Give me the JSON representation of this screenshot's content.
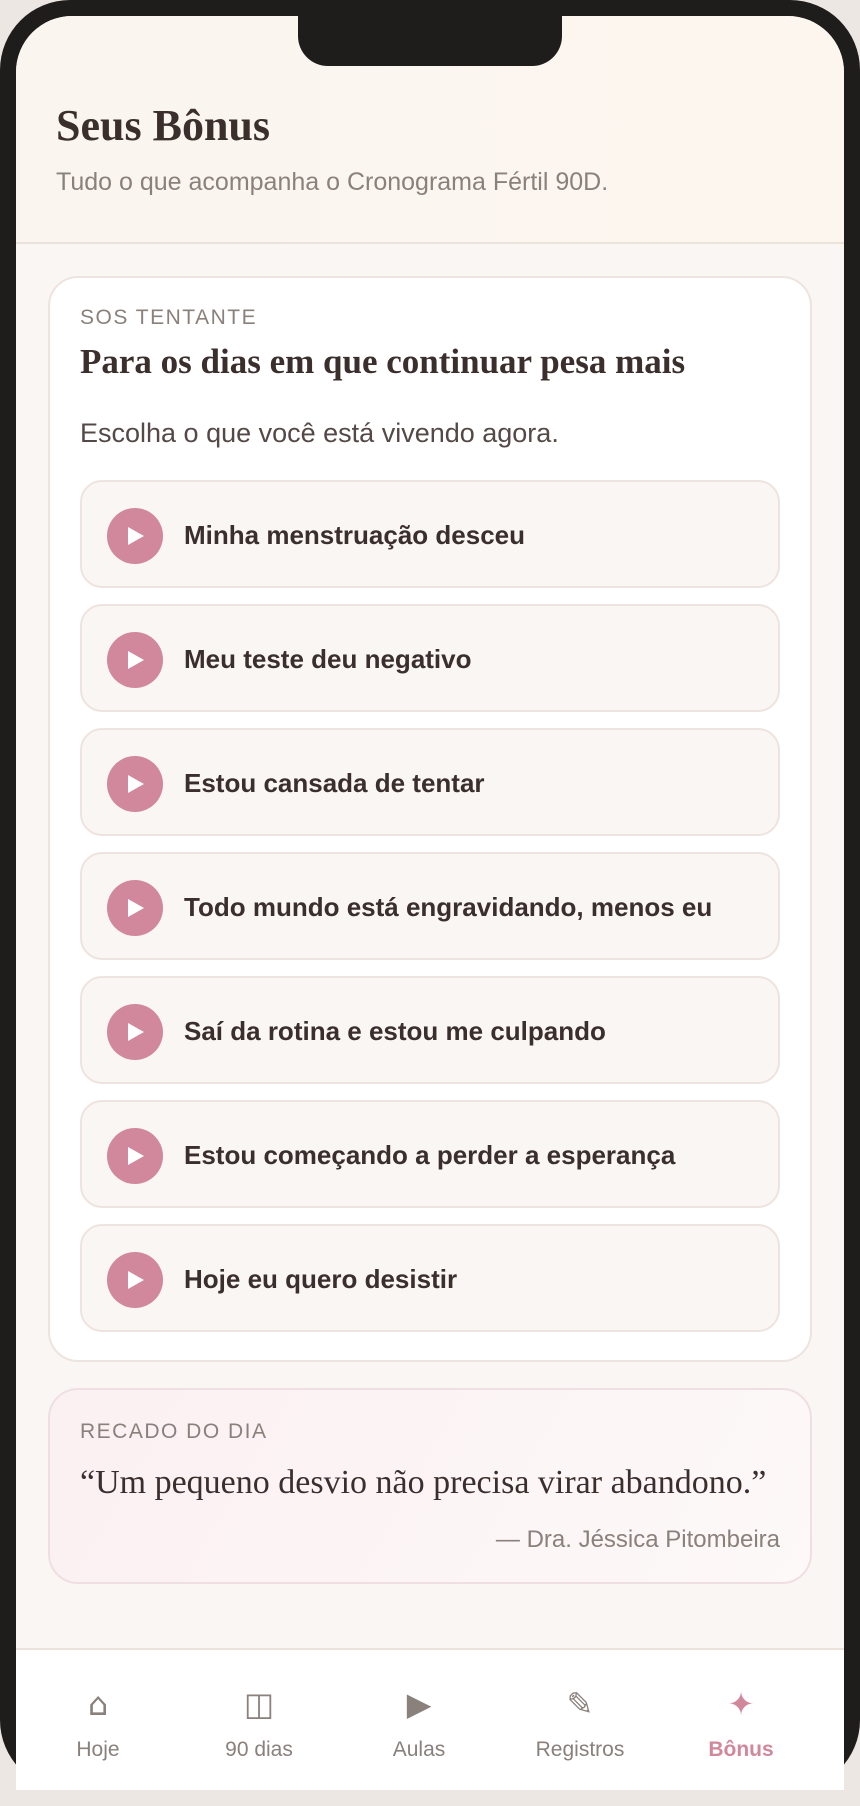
{
  "header": {
    "title": "Seus Bônus",
    "subtitle": "Tudo o que acompanha o Cronograma Fértil 90D."
  },
  "sos": {
    "kicker": "SOS TENTANTE",
    "title": "Para os dias em que continuar pesa mais",
    "lead": "Escolha o que você está vivendo agora.",
    "options": [
      {
        "label": "Minha menstruação desceu",
        "icon": "play-icon"
      },
      {
        "label": "Meu teste deu negativo",
        "icon": "play-icon"
      },
      {
        "label": "Estou cansada de tentar",
        "icon": "play-icon"
      },
      {
        "label": "Todo mundo está engravidando, menos eu",
        "icon": "play-icon"
      },
      {
        "label": "Saí da rotina e estou me culpando",
        "icon": "play-icon"
      },
      {
        "label": "Estou começando a perder a esperança",
        "icon": "play-icon"
      },
      {
        "label": "Hoje eu quero desistir",
        "icon": "play-icon"
      }
    ]
  },
  "daily_note": {
    "kicker": "RECADO DO DIA",
    "quote": "“Um pequeno desvio não precisa virar abandono.”",
    "author": "— Dra. Jéssica Pitombeira"
  },
  "tabbar": {
    "tabs": [
      {
        "label": "Hoje",
        "icon_glyph": "⌂",
        "icon": "home-icon",
        "active": false
      },
      {
        "label": "90 dias",
        "icon_glyph": "◫",
        "icon": "calendar-icon",
        "active": false
      },
      {
        "label": "Aulas",
        "icon_glyph": "▶",
        "icon": "play-icon",
        "active": false
      },
      {
        "label": "Registros",
        "icon_glyph": "✎",
        "icon": "pencil-icon",
        "active": false
      },
      {
        "label": "Bônus",
        "icon_glyph": "✦",
        "icon": "sparkle-icon",
        "active": true
      }
    ]
  },
  "colors": {
    "accent": "#d1889c",
    "text": "#3a2f2d",
    "muted": "#8a807c",
    "background": "#faf6f3"
  }
}
